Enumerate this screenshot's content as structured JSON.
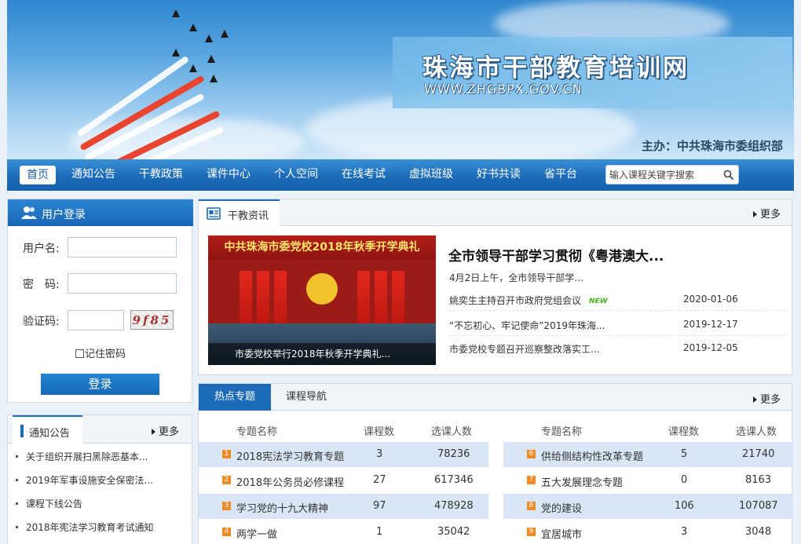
{
  "header": {
    "title": "珠海市干部教育培训网",
    "url": "WWW.ZHGBPX.GOV.CN",
    "sponsor": "主办：中共珠海市委组织部"
  },
  "nav": {
    "items": [
      "首页",
      "通知公告",
      "干教政策",
      "课件中心",
      "个人空间",
      "在线考试",
      "虚拟班级",
      "好书共读",
      "省平台"
    ],
    "search_placeholder": "输入课程关键字搜索"
  },
  "login": {
    "title": "用户登录",
    "username_label": "用户名:",
    "password_label": "密　码:",
    "captcha_label": "验证码:",
    "captcha_text": "9f85",
    "remember_label": "记住密码",
    "submit_label": "登录"
  },
  "notice": {
    "title": "通知公告",
    "more": "更多",
    "items": [
      "关于组织开展扫黑除恶基本...",
      "2019年军事设施安全保密法...",
      "课程下线公告",
      "2018年宪法学习教育考试通知"
    ]
  },
  "news": {
    "title": "干教资讯",
    "more": "更多",
    "photo_banner": "中共珠海市委党校2018年秋季开学典礼",
    "photo_caption": "市委党校举行2018年秋季开学典礼...",
    "headline": "全市领导干部学习贯彻《粤港澳大...",
    "summary": "4月2日上午，全市领导干部学…",
    "new_badge": "NEW",
    "items": [
      {
        "title": "姚奕生主持召开市政府党组会议",
        "date": "2020-01-06",
        "is_new": true
      },
      {
        "title": "“不忘初心、牢记使命”2019年珠海...",
        "date": "2019-12-17",
        "is_new": false
      },
      {
        "title": "市委党校专题召开巡察整改落实工...",
        "date": "2019-12-05",
        "is_new": false
      }
    ]
  },
  "topics": {
    "tabs": [
      "热点专题",
      "课程导航"
    ],
    "more": "更多",
    "columns": [
      "专题名称",
      "课程数",
      "选课人数"
    ],
    "left": [
      {
        "rank": "1",
        "name": "2018宪法学习教育专题",
        "courses": "3",
        "students": "78236"
      },
      {
        "rank": "2",
        "name": "2018年公务员必修课程",
        "courses": "27",
        "students": "617346"
      },
      {
        "rank": "3",
        "name": "学习党的十九大精神",
        "courses": "97",
        "students": "478928"
      },
      {
        "rank": "4",
        "name": "两学一做",
        "courses": "1",
        "students": "35042"
      }
    ],
    "right": [
      {
        "rank": "6",
        "name": "供给侧结构性改革专题",
        "courses": "5",
        "students": "21740"
      },
      {
        "rank": "7",
        "name": "五大发展理念专题",
        "courses": "0",
        "students": "8163"
      },
      {
        "rank": "8",
        "name": "党的建设",
        "courses": "106",
        "students": "107087"
      },
      {
        "rank": "9",
        "name": "宜居城市",
        "courses": "3",
        "students": "3048"
      }
    ]
  }
}
